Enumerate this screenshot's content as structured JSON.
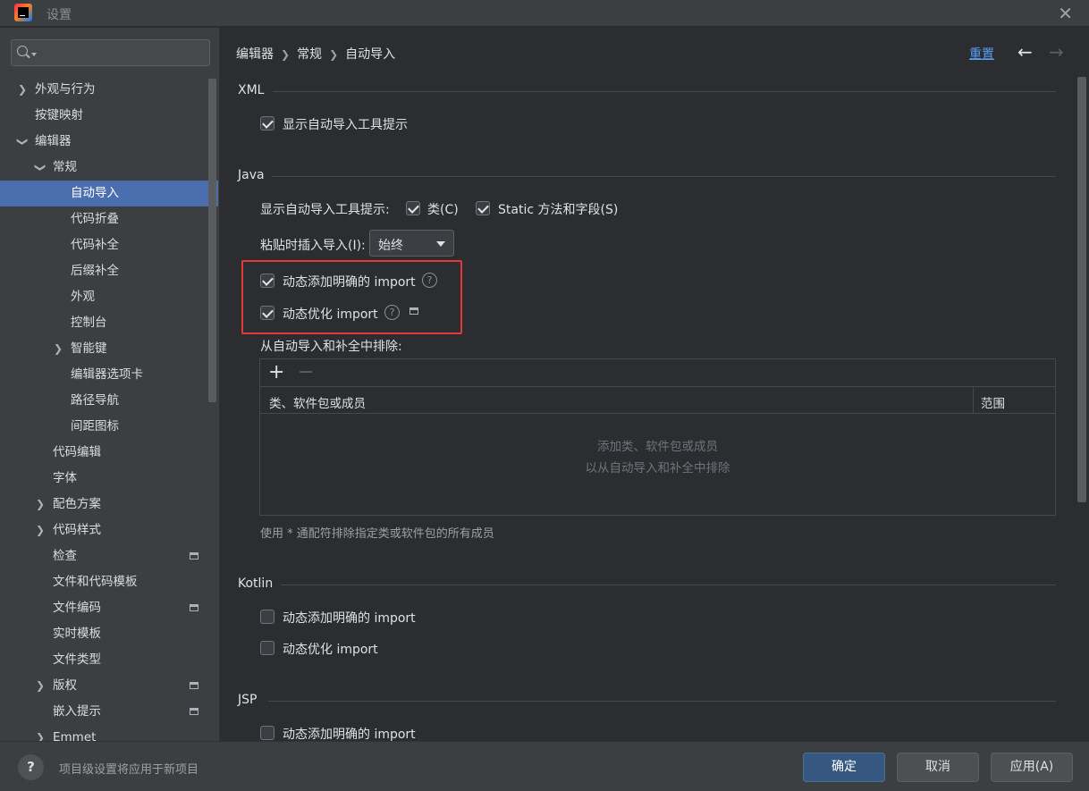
{
  "window": {
    "title": "设置",
    "close_icon": "close-icon"
  },
  "sidebar": {
    "search": {
      "placeholder": "",
      "value": ""
    },
    "items": [
      {
        "label": "外观与行为",
        "expanded": false
      },
      {
        "label": "按键映射"
      },
      {
        "label": "编辑器",
        "expanded": true
      },
      {
        "label": "常规",
        "expanded": true
      },
      {
        "label": "自动导入",
        "selected": true
      },
      {
        "label": "代码折叠"
      },
      {
        "label": "代码补全"
      },
      {
        "label": "后缀补全"
      },
      {
        "label": "外观"
      },
      {
        "label": "控制台"
      },
      {
        "label": "智能键",
        "expanded": false
      },
      {
        "label": "编辑器选项卡"
      },
      {
        "label": "路径导航"
      },
      {
        "label": "间距图标"
      },
      {
        "label": "代码编辑"
      },
      {
        "label": "字体"
      },
      {
        "label": "配色方案",
        "expanded": false
      },
      {
        "label": "代码样式",
        "expanded": false
      },
      {
        "label": "检查",
        "project_level": true
      },
      {
        "label": "文件和代码模板"
      },
      {
        "label": "文件编码",
        "project_level": true
      },
      {
        "label": "实时模板"
      },
      {
        "label": "文件类型"
      },
      {
        "label": "版权",
        "expanded": false,
        "project_level": true
      },
      {
        "label": "嵌入提示",
        "project_level": true
      },
      {
        "label": "Emmet",
        "expanded": false
      }
    ]
  },
  "header": {
    "breadcrumb": [
      "编辑器",
      "常规",
      "自动导入"
    ],
    "reset_label": "重置",
    "back_icon": "arrow-left-icon",
    "forward_icon": "arrow-right-icon"
  },
  "xml": {
    "title": "XML",
    "show_popup": {
      "label": "显示自动导入工具提示",
      "checked": true
    }
  },
  "java": {
    "title": "Java",
    "show_popup_label": "显示自动导入工具提示:",
    "classes": {
      "label": "类(C)",
      "checked": true
    },
    "static": {
      "label": "Static 方法和字段(S)",
      "checked": true
    },
    "paste_label": "粘贴时插入导入(I):",
    "paste_value": "始终",
    "add_unambiguous": {
      "label": "动态添加明确的 import",
      "checked": true
    },
    "optimize": {
      "label": "动态优化 import",
      "checked": true
    },
    "exclude_label": "从自动导入和补全中排除:",
    "table": {
      "col_member": "类、软件包或成员",
      "col_scope": "范围",
      "empty_line1": "添加类、软件包或成员",
      "empty_line2": "以从自动导入和补全中排除"
    },
    "hint": "使用 * 通配符排除指定类或软件包的所有成员"
  },
  "kotlin": {
    "title": "Kotlin",
    "add_unambiguous": {
      "label": "动态添加明确的 import",
      "checked": false
    },
    "optimize": {
      "label": "动态优化 import",
      "checked": false
    }
  },
  "jsp": {
    "title": "JSP",
    "add_unambiguous": {
      "label": "动态添加明确的 import",
      "checked": false
    }
  },
  "footer": {
    "note": "项目级设置将应用于新项目",
    "ok": "确定",
    "cancel": "取消",
    "apply": "应用(A)"
  },
  "colors": {
    "accent": "#4b6eaf",
    "link": "#589df6",
    "highlight": "#e53935",
    "primary_button": "#365880"
  }
}
